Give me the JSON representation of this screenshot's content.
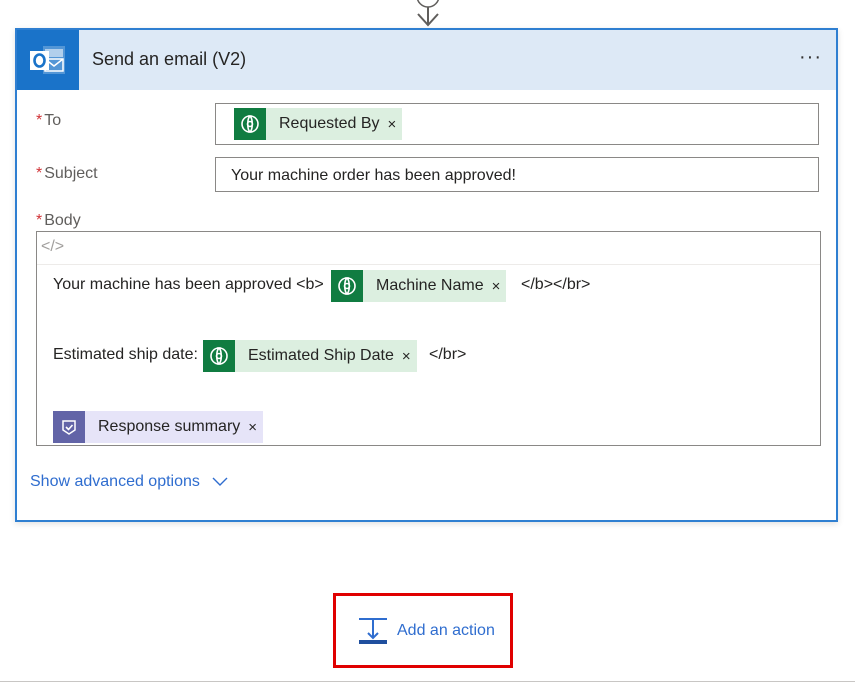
{
  "card": {
    "title": "Send an email (V2)",
    "more_label": "···",
    "app_icon": "outlook-icon"
  },
  "fields": {
    "to": {
      "label": "To",
      "required_mark": "*",
      "tokens": [
        {
          "label": "Requested By",
          "icon": "dataverse-icon",
          "remove": "×"
        }
      ]
    },
    "subject": {
      "label": "Subject",
      "required_mark": "*",
      "value": "Your machine order has been approved!"
    },
    "body": {
      "label": "Body",
      "required_mark": "*",
      "code_toggle": "</>",
      "line1": {
        "prefix": "Your machine has been approved <b>",
        "token": "Machine Name",
        "suffix": "</b></br>"
      },
      "line2": {
        "prefix": "Estimated ship date:",
        "token": "Estimated Ship Date",
        "suffix": "</br>"
      },
      "line3": {
        "token": "Response summary",
        "token_icon": "approvals-icon"
      },
      "remove": "×"
    }
  },
  "advanced": {
    "label": "Show advanced options"
  },
  "add_action": {
    "label": "Add an action"
  },
  "colors": {
    "accent": "#2f7fd1",
    "header_bg": "#dde9f6",
    "dataverse_green": "#107c41",
    "approvals_purple": "#6264a7",
    "highlight_red": "#e00000"
  }
}
